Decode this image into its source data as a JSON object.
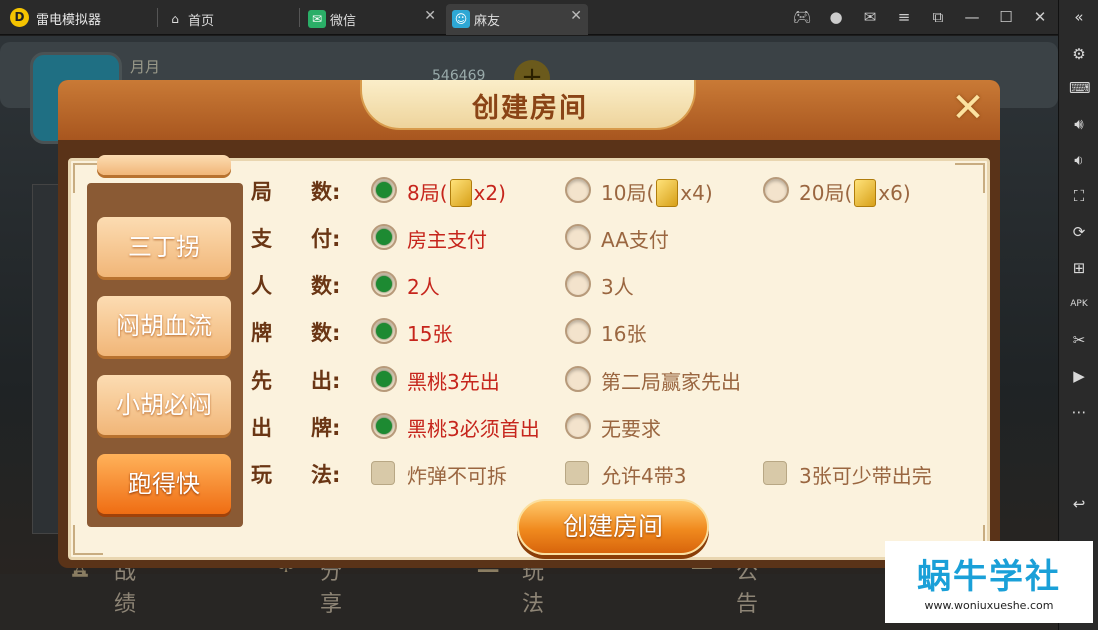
{
  "emulator": {
    "app_name": "雷电模拟器",
    "tabs": [
      {
        "label": "首页",
        "icon": "home-icon"
      },
      {
        "label": "微信",
        "icon": "wechat-icon"
      },
      {
        "label": "麻友",
        "icon": "mayou-app-icon"
      }
    ],
    "window_controls": [
      "gamepad-icon",
      "account-icon",
      "mail-icon",
      "menu-icon",
      "restore-icon",
      "minimize-icon",
      "maximize-icon",
      "close-icon"
    ],
    "sidebar_buttons": [
      "collapse-icon",
      "settings-icon",
      "keyboard-icon",
      "volume-up-icon",
      "volume-down-icon",
      "screenshot-icon",
      "rotate-icon",
      "add-app-icon",
      "apk-icon",
      "scissors-icon",
      "video-icon",
      "more-icon",
      "back-icon"
    ]
  },
  "game": {
    "nickname": "月月",
    "gold": "546469",
    "bottom_nav": [
      {
        "label": "战绩",
        "icon": "trophy-icon"
      },
      {
        "label": "分享",
        "icon": "share-icon"
      },
      {
        "label": "玩法",
        "icon": "rules-icon"
      },
      {
        "label": "公告",
        "icon": "notice-icon"
      }
    ]
  },
  "dialog": {
    "title": "创建房间",
    "modes": [
      "三丁拐",
      "闷胡血流",
      "小胡必闷",
      "跑得快"
    ],
    "active_mode": "跑得快",
    "rows": [
      {
        "label": [
          "局",
          "数:"
        ],
        "type": "radio",
        "options": [
          {
            "text": "8局(",
            "suffix": "x2)",
            "coin": true,
            "selected": true
          },
          {
            "text": "10局(",
            "suffix": "x4)",
            "coin": true,
            "selected": false
          },
          {
            "text": "20局(",
            "suffix": "x6)",
            "coin": true,
            "selected": false
          }
        ]
      },
      {
        "label": [
          "支",
          "付:"
        ],
        "type": "radio",
        "options": [
          {
            "text": "房主支付",
            "selected": true
          },
          {
            "text": "AA支付",
            "selected": false
          }
        ]
      },
      {
        "label": [
          "人",
          "数:"
        ],
        "type": "radio",
        "options": [
          {
            "text": "2人",
            "selected": true
          },
          {
            "text": "3人",
            "selected": false
          }
        ]
      },
      {
        "label": [
          "牌",
          "数:"
        ],
        "type": "radio",
        "options": [
          {
            "text": "15张",
            "selected": true
          },
          {
            "text": "16张",
            "selected": false
          }
        ]
      },
      {
        "label": [
          "先",
          "出:"
        ],
        "type": "radio",
        "options": [
          {
            "text": "黑桃3先出",
            "selected": true
          },
          {
            "text": "第二局赢家先出",
            "selected": false
          }
        ]
      },
      {
        "label": [
          "出",
          "牌:"
        ],
        "type": "radio",
        "options": [
          {
            "text": "黑桃3必须首出",
            "selected": true
          },
          {
            "text": "无要求",
            "selected": false
          }
        ]
      },
      {
        "label": [
          "玩",
          "法:"
        ],
        "type": "checkbox",
        "options": [
          {
            "text": "炸弹不可拆",
            "selected": false
          },
          {
            "text": "允许4带3",
            "selected": false
          },
          {
            "text": "3张可少带出完",
            "selected": false
          }
        ]
      }
    ],
    "create_button": "创建房间"
  },
  "watermark": {
    "title": "蜗牛学社",
    "url": "www.woniuxueshe.com"
  },
  "colors": {
    "selected_radio": "#1d8a32",
    "selected_text": "#c6251c",
    "unselected_text": "#9a6640",
    "label_text": "#6a3614",
    "active_mode": "#ef6d13"
  }
}
